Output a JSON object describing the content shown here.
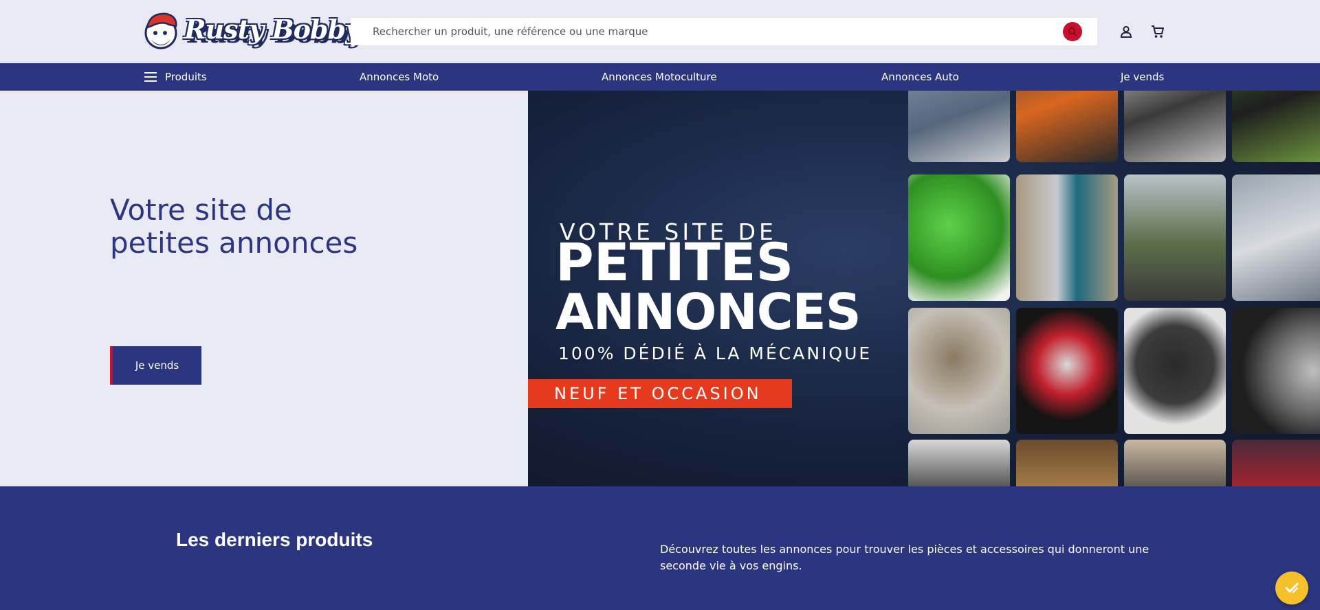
{
  "header": {
    "brand": "Rusty Bobby",
    "search_placeholder": "Rechercher un produit, une référence ou une marque"
  },
  "nav": {
    "items": [
      {
        "label": "Produits"
      },
      {
        "label": "Annonces Moto"
      },
      {
        "label": "Annonces Motoculture"
      },
      {
        "label": "Annonces Auto"
      },
      {
        "label": "Je vends"
      }
    ]
  },
  "hero": {
    "title_line1": "Votre site de",
    "title_line2": "petites annonces",
    "button": "Je vends"
  },
  "banner": {
    "line1": "VOTRE SITE DE",
    "line2": "PETITES",
    "line3": "ANNONCES",
    "line4": "100% DÉDIÉ À LA MÉCANIQUE",
    "tag": "NEUF ET OCCASION"
  },
  "latest": {
    "title": "Les derniers produits",
    "description": "Découvrez toutes les annonces pour trouver les pièces et accessoires qui donneront une seconde vie à vos engins."
  },
  "colors": {
    "primary": "#2b3580",
    "accent": "#c8102e",
    "banner_tag": "#e63a1e",
    "background": "#e9e9f4",
    "fab": "#f5c02a"
  },
  "icons": {
    "search": "search-icon",
    "account": "user-icon",
    "cart": "cart-icon",
    "menu": "menu-icon",
    "fab": "check-badge-icon"
  }
}
